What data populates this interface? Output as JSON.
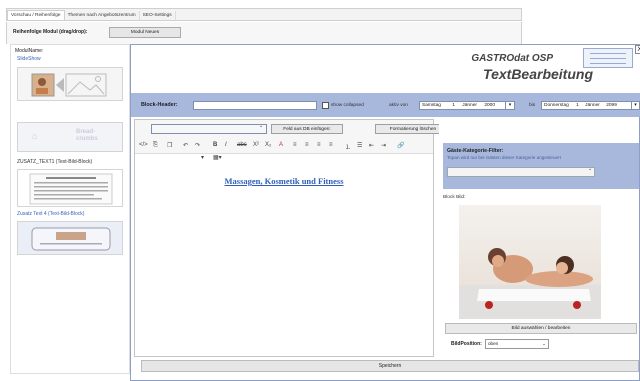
{
  "tabs": [
    "Vorschau / Reihenfolge",
    "Themen nach Angebotszentrum",
    "SEO-Settings"
  ],
  "reihenfolge": {
    "label": "Reihenfolge Modul (drag/drop):",
    "button": "Modul Neues"
  },
  "left_panel": {
    "title": "ModulName:",
    "slideshow_label": "SlideShow",
    "breadcrumbs_label": "Bread-crumbs",
    "zusatz_label": "ZUSATZ_TEXT1 (Text-Bild-Block)",
    "zusatz2_label": "Zusatz Text 4 (Text-Bild-Block)"
  },
  "brand": {
    "line1": "GASTROdat OSP",
    "line2": "TextBearbeitung",
    "close": "X"
  },
  "header_bar": {
    "block_header_label": "Block-Header:",
    "block_header_value": "",
    "show_collapsed": "show collapsed",
    "aktiv_von": "aktiv von",
    "from_day": "Samstag",
    "from_d": "1",
    "from_month": "Jänner",
    "from_year": "2000",
    "bis": "bis",
    "to_day": "Donnerstag",
    "to_d": "1",
    "to_month": "Jänner",
    "to_year": "2099"
  },
  "editor": {
    "insert_field_button": "Feld aus DB einfügen:",
    "remove_format_button": "Formatierung löschen",
    "content": "Massagen, Kosmetik und Fitness"
  },
  "filter": {
    "title": "Gäste-Kategorie-Filter:",
    "desc": "Topan wird nur bei Gästen dieser Kategorie angesteuert"
  },
  "image": {
    "block_bild_label": "Block Bild:",
    "select_button": "Bild auswählen / bearbeiten",
    "position_label": "BildPosition:",
    "position_value": "oben"
  },
  "save_button": "Speichern"
}
